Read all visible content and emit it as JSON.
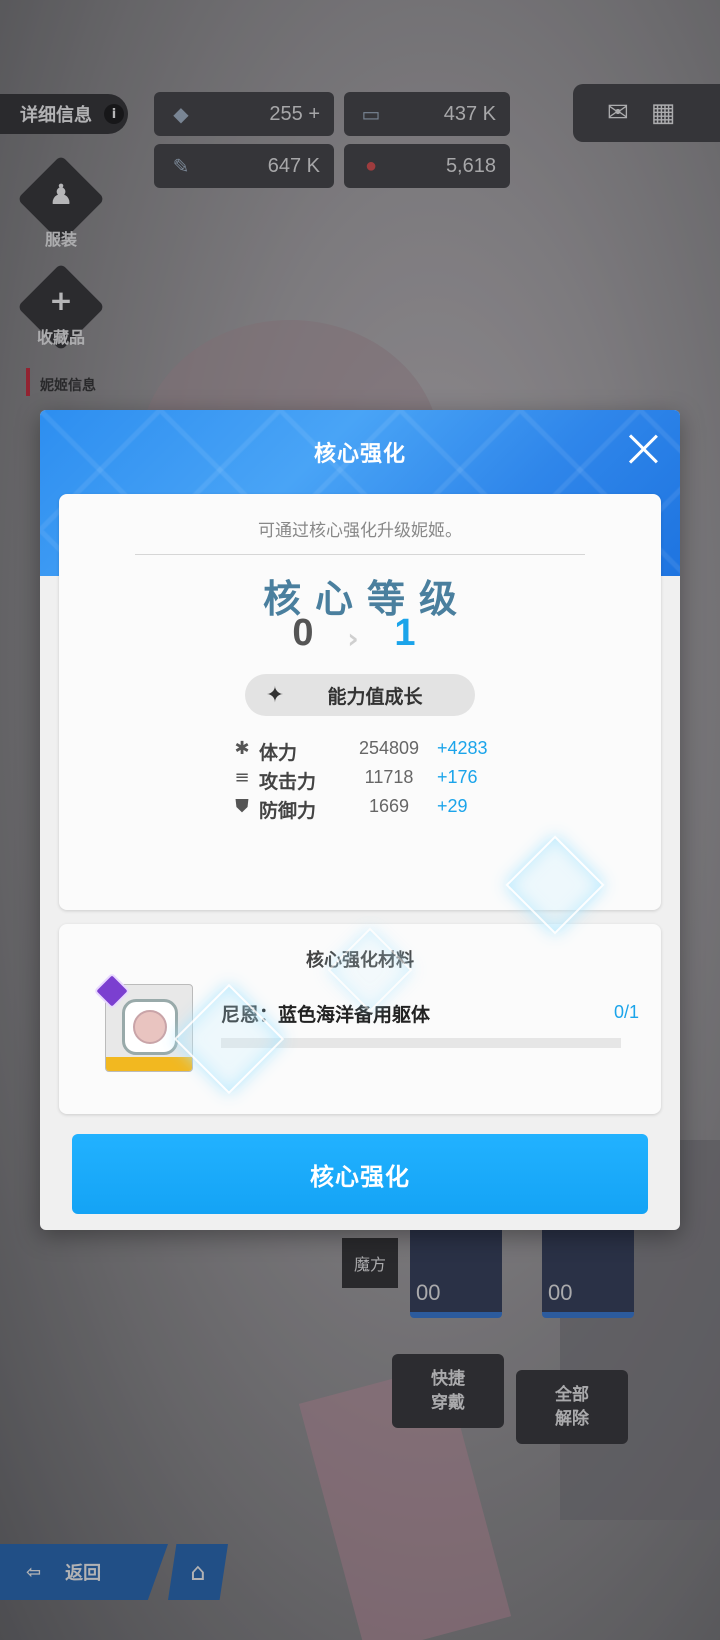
{
  "background": {
    "details_label": "详细信息",
    "info_icon": "i",
    "resources": [
      {
        "icon": "blue-crystal-icon",
        "value": "255",
        "plus": "+"
      },
      {
        "icon": "credit-card-icon",
        "value": "437 K"
      },
      {
        "icon": "syringe-icon",
        "value": "647 K"
      },
      {
        "icon": "red-core-icon",
        "value": "5,618"
      }
    ],
    "outfit_label": "服装",
    "collection_label": "收藏品",
    "nikke_info_label": "妮姬信息",
    "cube_label": "魔方",
    "equip_levels": [
      "00",
      "00"
    ],
    "quick_equip_label_1": "快捷",
    "quick_equip_label_2": "穿戴",
    "unequip_all_label_1": "全部",
    "unequip_all_label_2": "解除",
    "back_label": "返回"
  },
  "modal": {
    "title": "核心强化",
    "description": "可通过核心强化升级妮姬。",
    "level_title": "核心等级",
    "level_from": "0",
    "level_arrow": "›",
    "level_to": "1",
    "growth_label": "能力值成长",
    "stats": [
      {
        "icon": "hp-icon",
        "glyph": "✱",
        "name": "体力",
        "base": "254809",
        "plus": "+4283"
      },
      {
        "icon": "attack-icon",
        "glyph": "≡",
        "name": "攻击力",
        "base": "11718",
        "plus": "+176"
      },
      {
        "icon": "defense-icon",
        "glyph": "⛊",
        "name": "防御力",
        "base": "1669",
        "plus": "+29"
      }
    ],
    "materials_title": "核心强化材料",
    "material_name": "尼恩：蓝色海洋备用躯体",
    "material_count": "0/1",
    "material_progress": 0,
    "button_label": "核心强化"
  },
  "colors": {
    "accent": "#1ba4ea",
    "header_blue": "#2d8ef0",
    "level_title": "#4a7f9e"
  }
}
